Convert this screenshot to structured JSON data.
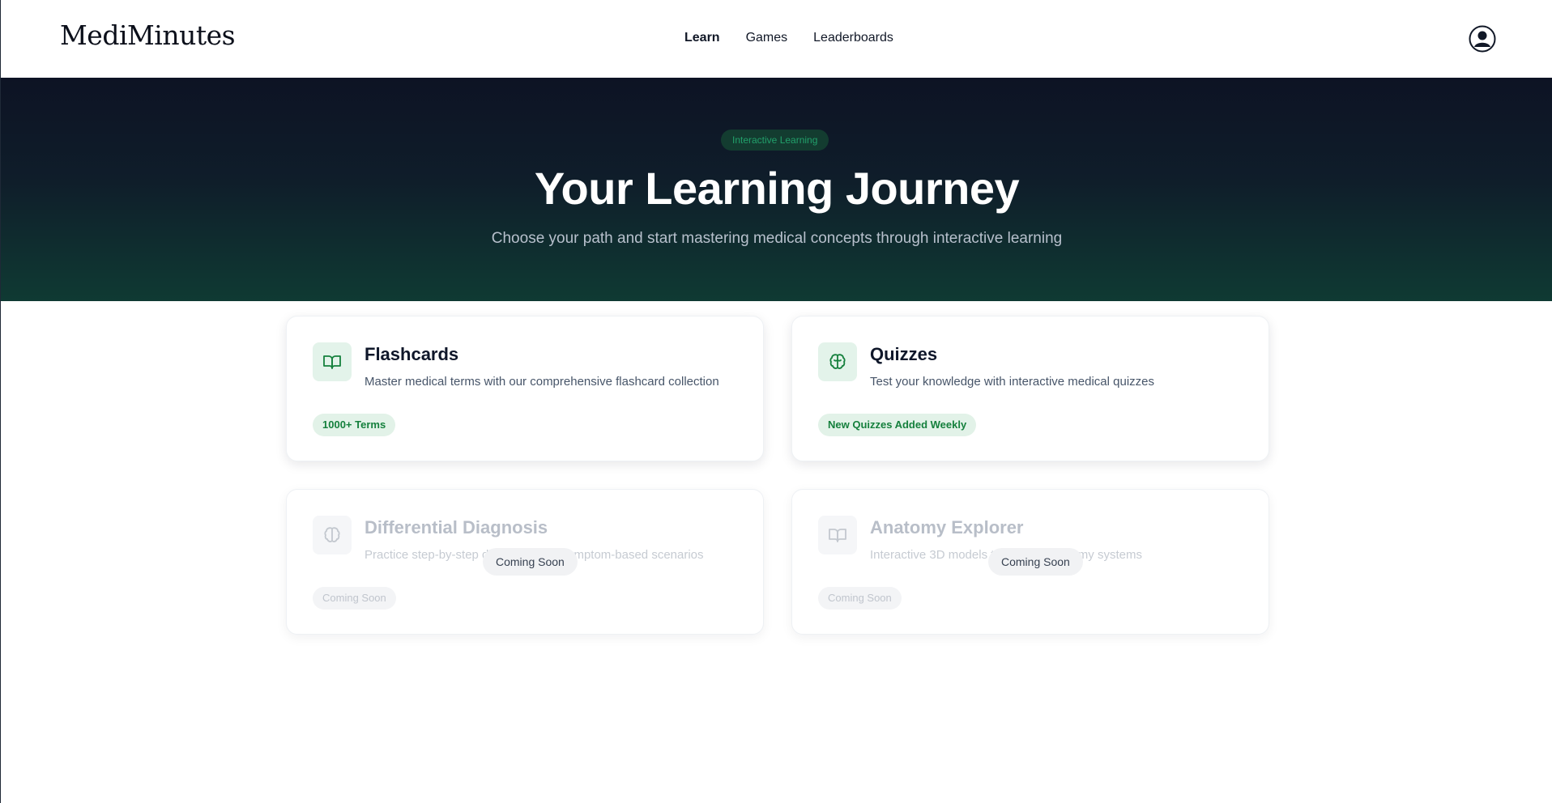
{
  "header": {
    "brand": "MediMinutes",
    "nav": [
      {
        "label": "Learn",
        "active": true
      },
      {
        "label": "Games",
        "active": false
      },
      {
        "label": "Leaderboards",
        "active": false
      }
    ],
    "profile_icon": "user-circle-icon"
  },
  "hero": {
    "badge": "Interactive Learning",
    "title": "Your Learning Journey",
    "subtitle": "Choose your path and start mastering medical concepts through interactive learning"
  },
  "cards": [
    {
      "title": "Flashcards",
      "description": "Master medical terms with our comprehensive flashcard collection",
      "tag": "1000+ Terms",
      "icon": "book-open-icon",
      "available": true
    },
    {
      "title": "Quizzes",
      "description": "Test your knowledge with interactive medical quizzes",
      "tag": "New Quizzes Added Weekly",
      "icon": "brain-icon",
      "available": true
    },
    {
      "title": "Differential Diagnosis",
      "description": "Practice step-by-step diagnosis with symptom-based scenarios",
      "tag": "Coming Soon",
      "overlay": "Coming Soon",
      "icon": "brain-icon",
      "available": false
    },
    {
      "title": "Anatomy Explorer",
      "description": "Interactive 3D models to explore anatomy systems",
      "tag": "Coming Soon",
      "overlay": "Coming Soon",
      "icon": "book-open-icon",
      "available": false
    }
  ],
  "colors": {
    "accent": "#15803d",
    "hero_top": "#0d1324",
    "hero_bottom": "#0f3a33"
  }
}
